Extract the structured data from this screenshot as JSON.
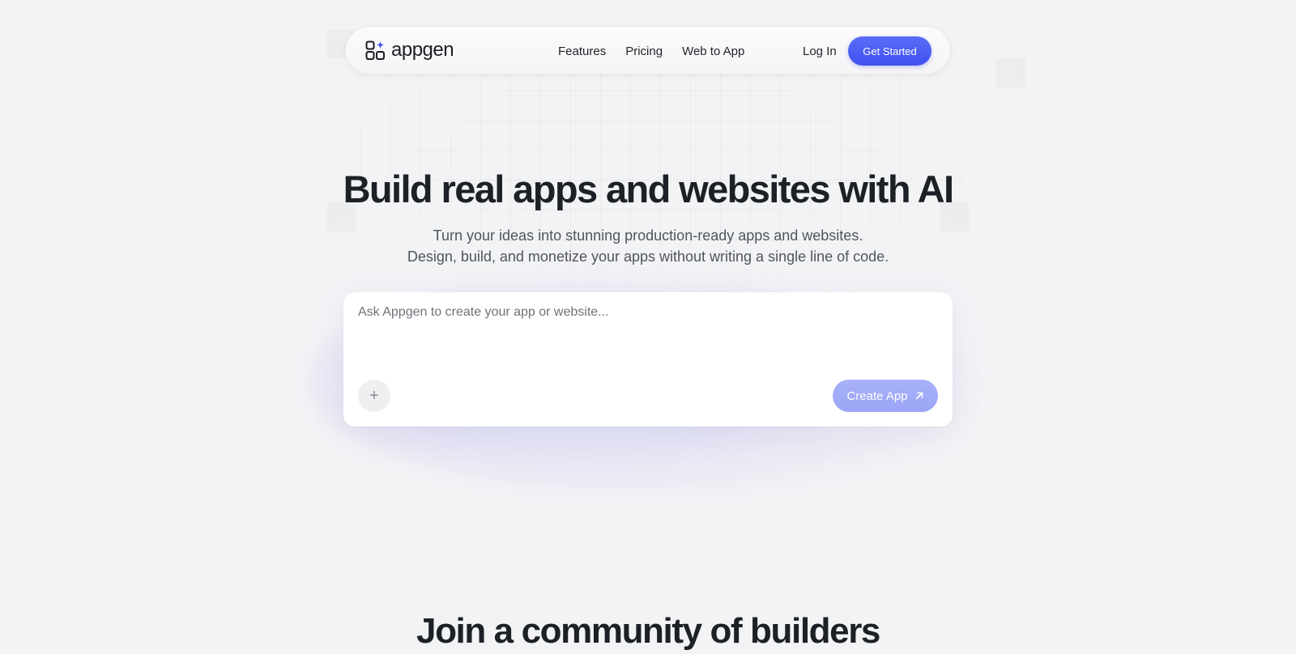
{
  "brand": {
    "name": "appgen",
    "accent": "#4353f0",
    "logo_icon": "app-grid-sparkle-icon"
  },
  "nav": {
    "links": [
      "Features",
      "Pricing",
      "Web to App"
    ],
    "login_label": "Log In",
    "cta_label": "Get Started"
  },
  "hero": {
    "title": "Build real apps and websites with AI",
    "subtitle_line1": "Turn your ideas into stunning production-ready apps and websites.",
    "subtitle_line2": "Design, build, and monetize your apps without writing a single line of code."
  },
  "prompt": {
    "placeholder": "Ask Appgen to create your app or website...",
    "value": "",
    "attach_icon": "plus-icon",
    "attach_symbol": "+",
    "submit_label": "Create App",
    "submit_icon": "arrow-up-right-icon"
  },
  "community": {
    "title": "Join a community of builders"
  }
}
